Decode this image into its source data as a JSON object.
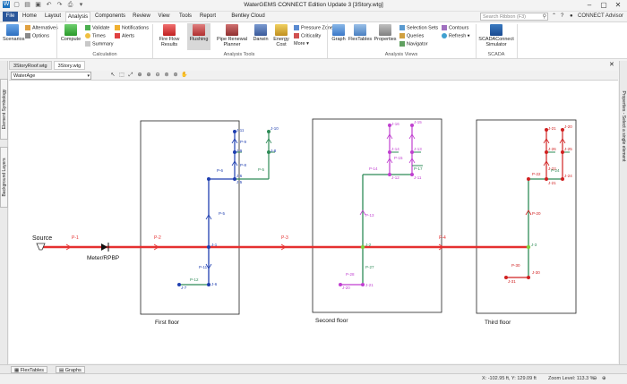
{
  "window": {
    "title": "WaterGEMS CONNECT Edition Update 3 [3Story.wtg]"
  },
  "tabs": [
    "File",
    "Home",
    "Layout",
    "Analysis",
    "Components",
    "Review",
    "View",
    "Tools",
    "Report",
    "Bentley Cloud Services"
  ],
  "search": {
    "placeholder": "Search Ribbon (F3)"
  },
  "account": {
    "label": "CONNECT Advisor"
  },
  "ribbon": {
    "scenarios": "Scenarios",
    "alternatives": "Alternatives",
    "options": "Options",
    "compute": "Compute",
    "validate": "Validate",
    "times": "Times",
    "summary": "Summary",
    "notifications": "Notifications",
    "alerts": "Alerts",
    "group_calculation": "Calculation",
    "fire_flow_results": "Fire Flow Results",
    "flushing": "Flushing",
    "pipe_renewal": "Pipe Renewal Planner",
    "darwin": "Darwin",
    "energy_cost": "Energy Cost",
    "pressure_zone": "Pressure Zone",
    "criticality": "Criticality",
    "more": "More",
    "group_analysis_tools": "Analysis Tools",
    "graph": "Graph",
    "flextables": "FlexTables",
    "properties": "Properties",
    "selection_sets": "Selection Sets",
    "queries": "Queries",
    "navigator": "Navigator",
    "contours": "Contours",
    "refresh": "Refresh",
    "group_analysis_views": "Analysis Views",
    "scadaconnect": "SCADAConnect Simulator",
    "group_scada": "SCADA"
  },
  "doc_tabs": [
    "3StoryRoof.wtg",
    "3Story.wtg"
  ],
  "side_panels": {
    "left": [
      "Element Symbology",
      "Background Layers"
    ],
    "right": "Properties - Select a single element"
  },
  "toolbar": {
    "layer_combo": "WaterAge"
  },
  "network": {
    "source": "Source",
    "meter": "Meter/RPBP",
    "floors": [
      "First floor",
      "Second floor",
      "Third floor"
    ],
    "mains": [
      "P-1",
      "P-2",
      "P-3",
      "P-4"
    ],
    "floor1": {
      "nodes": [
        "J-11",
        "J-10",
        "J-9",
        "J-8",
        "J-6",
        "J-5",
        "J-4",
        "J-7",
        "J-6"
      ],
      "pipes": [
        "P-9",
        "P-8",
        "P-6",
        "P-5",
        "P-4",
        "P-11",
        "P-12"
      ],
      "nodes_rendered": [
        "J-11",
        "J-10",
        "J-9",
        "J-8",
        "J-6",
        "J-5",
        "J-1",
        "J-7",
        "J-6"
      ],
      "pipes_rendered": [
        "P-9",
        "P-8",
        "P-6",
        "P-5",
        "P-5",
        "P-11",
        "P-12"
      ]
    },
    "floor2": {
      "nodes": [
        "J-16",
        "J-15",
        "J-14",
        "J-13",
        "J-12",
        "J-11",
        "J-2",
        "J-20",
        "J-21"
      ],
      "pipes": [
        "P-14",
        "P-15",
        "P-17",
        "P-13",
        "P-28",
        "P-27"
      ]
    },
    "floor3": {
      "nodes": [
        "J-21",
        "J-20",
        "J-26",
        "J-25",
        "J-22",
        "J-24",
        "J-21",
        "J-3",
        "J-30",
        "J-31"
      ],
      "pipes": [
        "P-22",
        "P-24",
        "P-20",
        "P-30"
      ]
    }
  },
  "bottom_tabs": [
    "FlexTables",
    "Graphs"
  ],
  "status": {
    "coords": "X: -102.95 ft, Y: 129.09 ft",
    "zoom": "Zoom Level: 113.3 %"
  },
  "colors": {
    "main_pipe": "#e53030",
    "floor1": "#1f3fb0",
    "floor2": "#c03fd0",
    "floor3": "#d02020",
    "riser": "#2e8b57"
  }
}
